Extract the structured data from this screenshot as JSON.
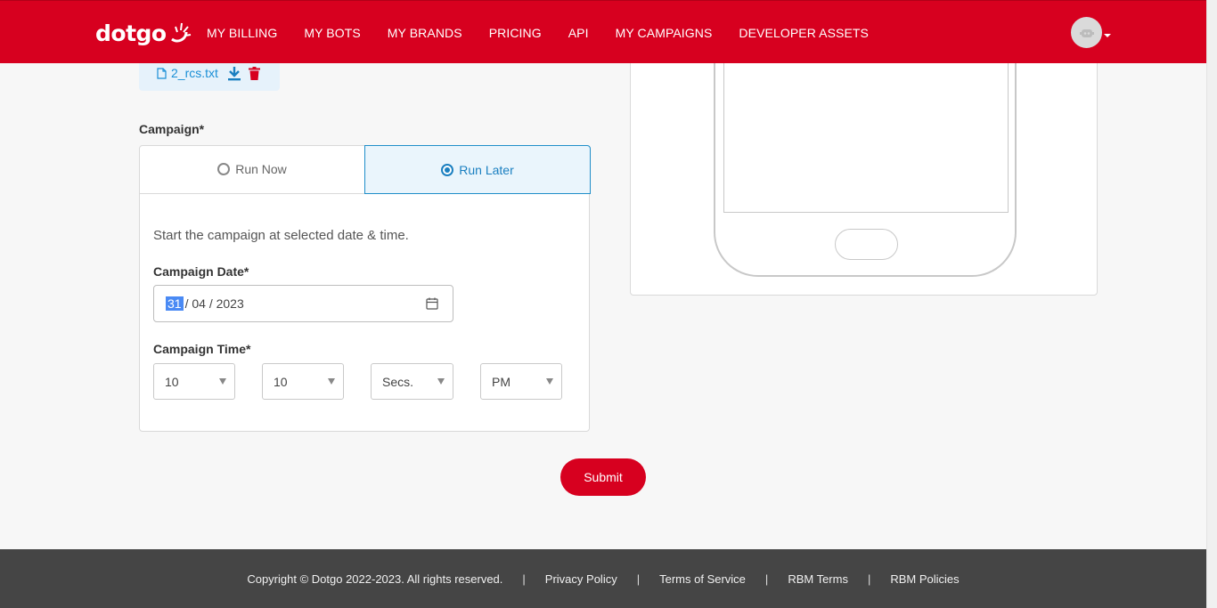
{
  "brand": {
    "logo_text": "dotgo",
    "accent": "#d7001f"
  },
  "nav": {
    "items": [
      "MY BILLING",
      "MY BOTS",
      "MY BRANDS",
      "PRICING",
      "API",
      "MY CAMPAIGNS",
      "DEVELOPER ASSETS"
    ]
  },
  "file": {
    "name": "2_rcs.txt",
    "icons": [
      "file-icon",
      "download-icon",
      "trash-icon"
    ]
  },
  "campaign": {
    "label": "Campaign*",
    "tabs": [
      {
        "label": "Run Now",
        "selected": false
      },
      {
        "label": "Run Later",
        "selected": true
      }
    ],
    "description": "Start the campaign at selected date & time.",
    "date_label": "Campaign Date*",
    "date": {
      "day": "31",
      "rest": "/ 04 / 2023"
    },
    "time_label": "Campaign Time*",
    "time": {
      "hours": "10",
      "minutes": "10",
      "seconds": "Secs.",
      "ampm": "PM"
    }
  },
  "submit_label": "Submit",
  "footer": {
    "copyright": "Copyright © Dotgo 2022-2023. All rights reserved.",
    "separator": "|",
    "links": [
      "Privacy Policy",
      "Terms of Service",
      "RBM Terms",
      "RBM Policies"
    ]
  }
}
